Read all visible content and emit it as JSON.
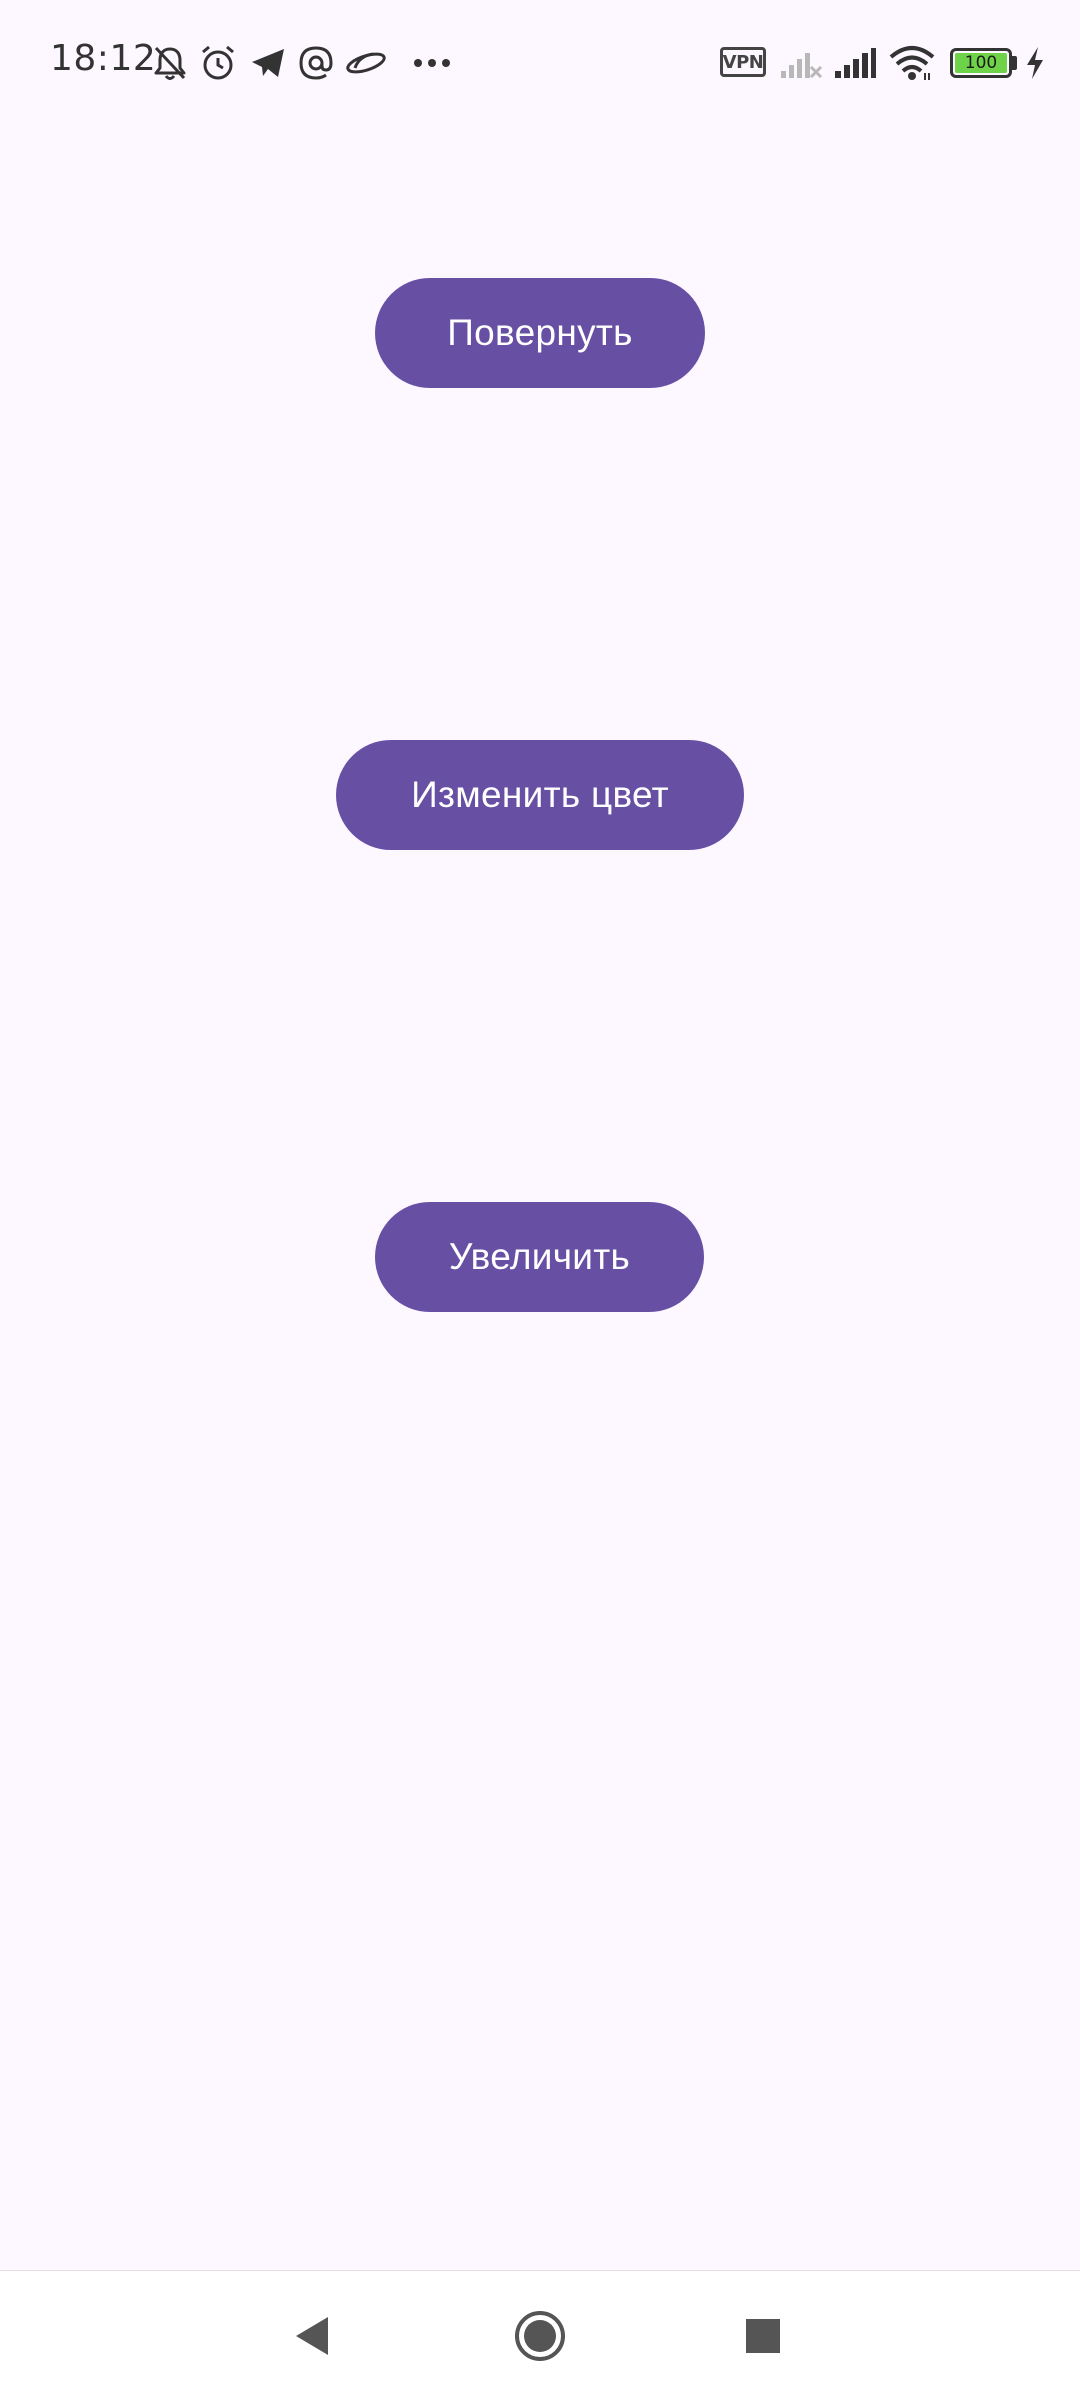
{
  "status_bar": {
    "time": "18:12",
    "vpn_label": "VPN",
    "battery_level": "100",
    "battery_fill_fraction": 1.0,
    "icons": [
      "mute-bell-icon",
      "alarm-icon",
      "telegram-icon",
      "mail-at-icon",
      "planet-icon",
      "more-dots-icon",
      "cell-signal-empty-icon",
      "cell-signal-full-icon",
      "wifi-icon",
      "battery-icon",
      "charging-bolt-icon"
    ]
  },
  "main": {
    "buttons": [
      {
        "label": "Повернуть"
      },
      {
        "label": "Изменить цвет"
      },
      {
        "label": "Увеличить"
      }
    ]
  },
  "colors": {
    "background": "#fdf7ff",
    "button": "#6750a4",
    "button_text": "#ffffff",
    "battery": "#6fd34a"
  },
  "nav_bar": {
    "icons": [
      "back-icon",
      "home-icon",
      "recents-icon"
    ]
  }
}
